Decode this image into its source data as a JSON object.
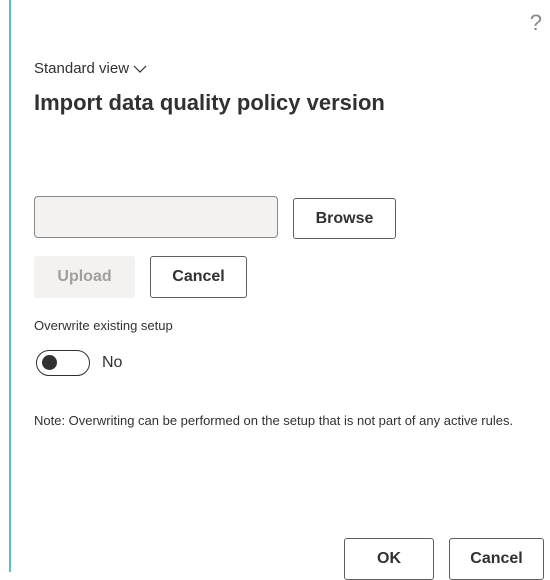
{
  "help": {
    "glyph": "?"
  },
  "header": {
    "view_label": "Standard view",
    "title": "Import data quality policy version"
  },
  "file": {
    "value": "",
    "browse_label": "Browse"
  },
  "actions": {
    "upload_label": "Upload",
    "cancel_label": "Cancel"
  },
  "overwrite": {
    "label": "Overwrite existing setup",
    "state_text": "No",
    "checked": false
  },
  "note": "Note: Overwriting can be performed on the setup that is not part of any active rules.",
  "footer": {
    "ok_label": "OK",
    "cancel_label": "Cancel"
  },
  "colors": {
    "accent_border": "#5fbcc7",
    "disabled_bg": "#f3f2f1",
    "text": "#323130"
  }
}
